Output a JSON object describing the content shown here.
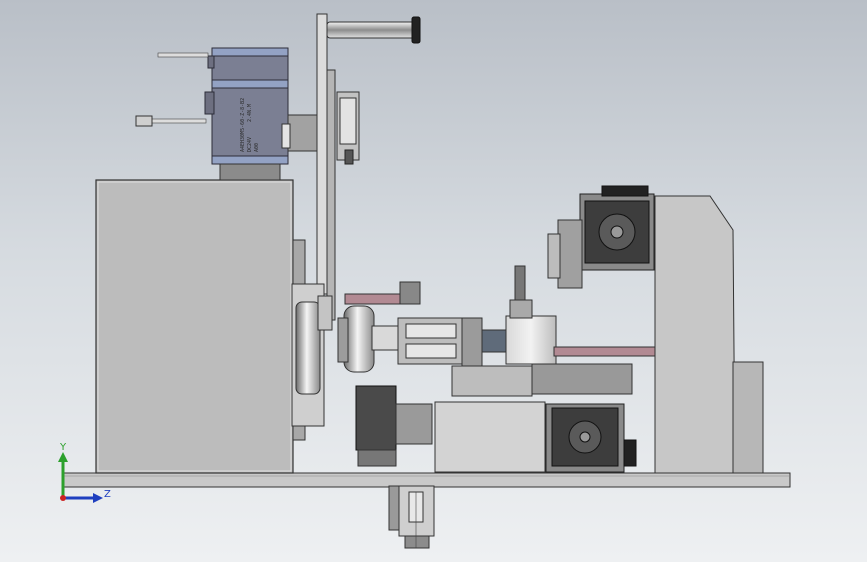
{
  "view": {
    "triad": {
      "y_label": "Y",
      "z_label": "Z"
    },
    "motor": {
      "label_line1": "A4EH30M5-60-Z-8-B2",
      "label_line2": "DC24V",
      "label_line3": "2.4N.M",
      "label_line4": "A00"
    }
  }
}
